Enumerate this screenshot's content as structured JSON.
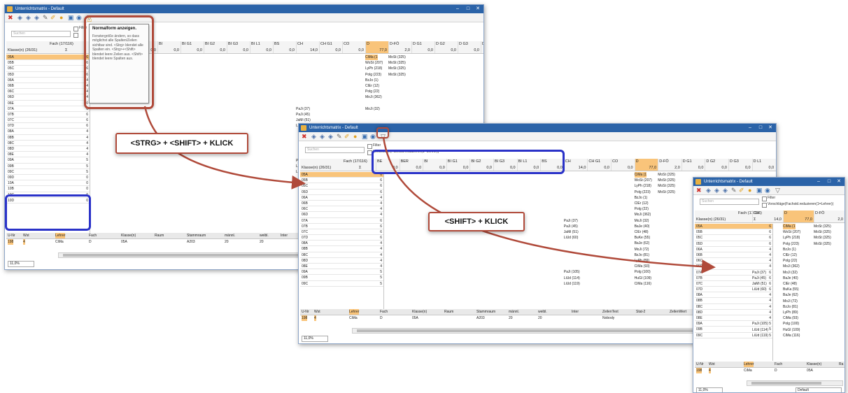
{
  "window_title": "Unterrichtsmatrix - Default",
  "window_controls": {
    "minimize": "–",
    "maximize": "□",
    "close": "✕"
  },
  "search_placeholder": "Suchen",
  "filter_label": "Filter",
  "vorschlag_label": "Vorschläge(Fachstd.reduzieren(1=Lehrer))",
  "vorschlag_short": "Vorsc",
  "fach_header": "Fach (17/116)",
  "klasse_header": "Klasse(n) (26/31)",
  "sigma": "Σ",
  "tooltip": {
    "title": "Normalform anzeigen.",
    "body": "Fenstergröße ändern, so dass möglichst alle Spalten/Zeilen sichtbar sind. <Strg> blendet alle Spalten ein. <Strg>+<Shift> blendet leere Zeilen aus. <Shift> blendet leere Spalten aus."
  },
  "callouts": {
    "strg_shift": "<STRG> + <SHIFT> + KLICK",
    "shift": "<SHIFT> + KLICK"
  },
  "w1": {
    "subjects": [
      "BE",
      "BER",
      "BI",
      "BI G1",
      "BI G2",
      "BI G3",
      "BI L1",
      "BS",
      "CH",
      "CH G1",
      "CO",
      "D",
      "D-FÖ",
      "D G1",
      "D G2",
      "D G3",
      "D L1"
    ],
    "sums": [
      "",
      "0,0",
      "0,0",
      "0,0",
      "0,0",
      "0,0",
      "0,0",
      "0,0",
      "14,0",
      "0,0",
      "0,0",
      "77,0",
      "2,0",
      "0,0",
      "0,0",
      "0,0",
      "0,0"
    ],
    "classes": [
      "05A",
      "05B",
      "05C",
      "05D",
      "06A",
      "06B",
      "06C",
      "06D",
      "06E",
      "07A",
      "07B",
      "07C",
      "07D",
      "08A",
      "08B",
      "08C",
      "08D",
      "08E",
      "09A",
      "09B",
      "09C",
      "09D",
      "10A",
      "10B",
      "10C",
      "10D"
    ],
    "counts": [
      "6",
      "6",
      "6",
      "6",
      "4",
      "4",
      "4",
      "4",
      "0",
      "6",
      "6",
      "6",
      "6",
      "4",
      "4",
      "4",
      "4",
      "4",
      "5",
      "5",
      "5",
      "0",
      "0",
      "0",
      "0",
      "0"
    ],
    "ch_cells": [
      {
        "row": 9,
        "text": "PaJi (37)"
      },
      {
        "row": 10,
        "text": "PaJi (45)"
      },
      {
        "row": 11,
        "text": "JaMi (51)"
      },
      {
        "row": 12,
        "text": "LiUd (60)"
      },
      {
        "row": 18,
        "text": "PaJi (105)"
      },
      {
        "row": 19,
        "text": "LiUd (114)"
      },
      {
        "row": 20,
        "text": "LiUd (119)"
      }
    ],
    "d_cells": [
      {
        "row": 0,
        "text": "CiMa (1"
      },
      {
        "row": 1,
        "text": "WoSt (207)"
      },
      {
        "row": 2,
        "text": "LyPh (218)"
      },
      {
        "row": 3,
        "text": "Polg (223)"
      },
      {
        "row": 4,
        "text": "BzJo (1)"
      },
      {
        "row": 5,
        "text": "ClEr (12)"
      },
      {
        "row": 6,
        "text": "Polg (22)"
      },
      {
        "row": 7,
        "text": "MoJi (362)"
      },
      {
        "row": 9,
        "text": "MoJi (32)"
      }
    ],
    "dfo_cells": [
      {
        "row": 0,
        "text": "MoSt (325)"
      },
      {
        "row": 1,
        "text": "MoSt (325)"
      },
      {
        "row": 2,
        "text": "MoSt (325)"
      },
      {
        "row": 3,
        "text": "MoSt (325)"
      }
    ],
    "bottom_headers": [
      "U-Nr",
      "Wst",
      "Lehrer",
      "Fach",
      "Klasse(n)",
      "Raum",
      "Stammraum",
      "männl.",
      "weibl.",
      "Inter"
    ],
    "bottom_values": [
      "198",
      "4",
      "CiMa",
      "D",
      "05A",
      "",
      "A203",
      "20",
      "20",
      ""
    ],
    "zoom": "11,0%"
  },
  "w2": {
    "subjects": [
      "BE",
      "BER",
      "BI",
      "BI G1",
      "BI G2",
      "BI G3",
      "BI L1",
      "BS",
      "CH",
      "CH G1",
      "CO",
      "D",
      "D-FÖ",
      "D G1",
      "D G2",
      "D G3",
      "D L1"
    ],
    "sums": [
      "0,0",
      "0,0",
      "0,0",
      "0,0",
      "0,0",
      "0,0",
      "0,0",
      "0,0",
      "14,0",
      "0,0",
      "0,0",
      "77,0",
      "2,0",
      "0,0",
      "0,0",
      "0,0",
      "0,0"
    ],
    "classes": [
      "05A",
      "05B",
      "05C",
      "05D",
      "06A",
      "06B",
      "06C",
      "06D",
      "07A",
      "07B",
      "07C",
      "07D",
      "08A",
      "08B",
      "08C",
      "08D",
      "08E",
      "09A",
      "09B",
      "09C"
    ],
    "counts": [
      "6",
      "6",
      "6",
      "6",
      "4",
      "4",
      "4",
      "4",
      "6",
      "6",
      "6",
      "6",
      "4",
      "4",
      "4",
      "4",
      "4",
      "5",
      "5",
      "5"
    ],
    "ch_cells": [
      {
        "row": 8,
        "text": "PaJi (37)"
      },
      {
        "row": 9,
        "text": "PaJi (45)"
      },
      {
        "row": 10,
        "text": "JaMi (51)"
      },
      {
        "row": 11,
        "text": "LiUd (60)"
      },
      {
        "row": 17,
        "text": "PaJi (105)"
      },
      {
        "row": 18,
        "text": "LiUd (114)"
      },
      {
        "row": 19,
        "text": "LiUd (119)"
      }
    ],
    "d_cells": [
      "CiMa (1",
      "WoSt (207)",
      "LyPh (218)",
      "Polg (223)",
      "BzJo (1)",
      "ClEr (12)",
      "Polg (22)",
      "MoJi (362)",
      "MoJi (32)",
      "BaJe (40)",
      "ClEr (48)",
      "BuKe (55)",
      "BaJe (62)",
      "MoJi (72)",
      "BzJo (81)",
      "LyPh (89)",
      "CiMa (93)",
      "Polg (100)",
      "HuGl (109)",
      "CiMa (116)"
    ],
    "dfo_cells": [
      "MoSt (325)",
      "MoSt (325)",
      "MoSt (325)",
      "MoSt (325)"
    ],
    "bottom_headers": [
      "U-Nr",
      "Wst",
      "Lehrer",
      "Fach",
      "Klasse(n)",
      "Raum",
      "Stammraum",
      "männl.",
      "weibl.",
      "Inter",
      "ZeilenText",
      "Stat-2",
      "ZeilenWert"
    ],
    "bottom_values": [
      "198",
      "4",
      "CiMa",
      "D",
      "05A",
      "",
      "A203",
      "20",
      "20",
      "",
      "Nobody",
      "",
      ""
    ],
    "zoom": "11,0%"
  },
  "w3": {
    "subjects": [
      "CH",
      "D",
      "D-FÖ"
    ],
    "sums": [
      "14,0",
      "77,0",
      "2,0"
    ],
    "classes": [
      "05A",
      "05B",
      "05C",
      "05D",
      "06A",
      "06B",
      "06C",
      "06D",
      "07A",
      "07B",
      "07C",
      "07D",
      "08A",
      "08B",
      "08C",
      "08D",
      "08E",
      "09A",
      "09B",
      "09C"
    ],
    "counts": [
      "6",
      "6",
      "6",
      "6",
      "4",
      "4",
      "4",
      "4",
      "6",
      "6",
      "6",
      "6",
      "4",
      "4",
      "4",
      "4",
      "4",
      "5",
      "5",
      "5"
    ],
    "ch_cells": [
      "",
      "",
      "",
      "",
      "",
      "",
      "",
      "",
      "PaJi (37)",
      "PaJi (45)",
      "JaMi (51)",
      "LiUd (60)",
      "",
      "",
      "",
      "",
      "",
      "PaJi (105)",
      "LiUd (114)",
      "LiUd (119)"
    ],
    "d_cells": [
      "CiMa (1",
      "WoSt (207)",
      "LyPh (218)",
      "Polg (223)",
      "BzJo (1)",
      "ClEr (12)",
      "Polg (22)",
      "MoJi (362)",
      "MoJi (32)",
      "BaJe (40)",
      "ClEr (48)",
      "BuKa (55)",
      "BaJe (62)",
      "MoJi (72)",
      "BzJo (81)",
      "LyPh (89)",
      "CiMa (93)",
      "Polg (100)",
      "HuGl (109)",
      "CiMa (116)"
    ],
    "dfo_cells": [
      "MoSt (325)",
      "MoSt (325)",
      "MoSt (325)",
      "MoSt (325)"
    ],
    "bottom_headers": [
      "U-Nr",
      "Wst",
      "Lehrer",
      "Fach",
      "Klasse(n)",
      "Ra"
    ],
    "bottom_values": [
      "198",
      "4",
      "CiMa",
      "D",
      "05A",
      ""
    ],
    "zoom": "11,0%",
    "status": "Default"
  }
}
